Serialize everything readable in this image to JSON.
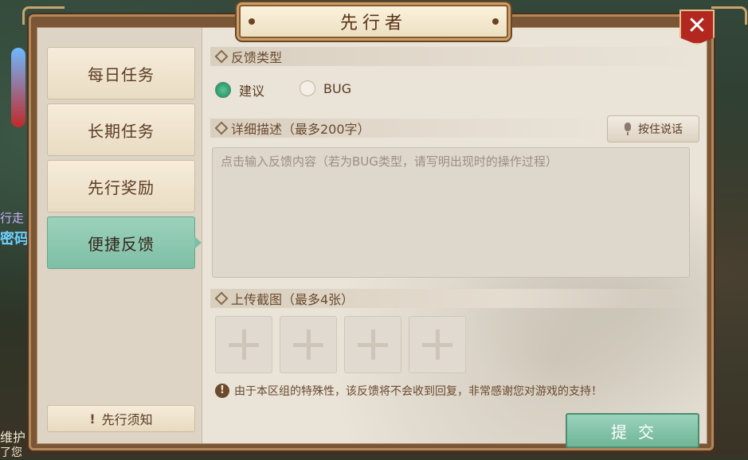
{
  "window": {
    "title": "先行者"
  },
  "background": {
    "lines": [
      "行走",
      "密码",
      "维护",
      "了您"
    ]
  },
  "sidebar": {
    "tabs": [
      {
        "label": "每日任务",
        "active": false
      },
      {
        "label": "长期任务",
        "active": false
      },
      {
        "label": "先行奖励",
        "active": false
      },
      {
        "label": "便捷反馈",
        "active": true
      }
    ],
    "notice_button": {
      "icon": "!",
      "label": "先行须知"
    }
  },
  "feedback": {
    "type_section": {
      "label": "反馈类型"
    },
    "options": [
      {
        "label": "建议",
        "checked": true
      },
      {
        "label": "BUG",
        "checked": false
      }
    ],
    "detail_section": {
      "label": "详细描述（最多200字）"
    },
    "voice_button": {
      "label": "按住说话",
      "icon": "microphone-icon"
    },
    "textarea": {
      "placeholder": "点击输入反馈内容（若为BUG类型，请写明出现时的操作过程）",
      "value": ""
    },
    "upload_section": {
      "label": "上传截图（最多4张）"
    },
    "upload_slots": 4,
    "tip": {
      "icon": "!",
      "text": "由于本区组的特殊性，该反馈将不会收到回复，非常感谢您对游戏的支持！"
    },
    "submit_button": {
      "label": "提交"
    }
  },
  "close_button": {
    "icon": "close-icon",
    "glyph": "✕"
  },
  "colors": {
    "accent": "#7fbfa6",
    "frame": "#7a5636",
    "close": "#b2271f",
    "text": "#5b3b22"
  }
}
